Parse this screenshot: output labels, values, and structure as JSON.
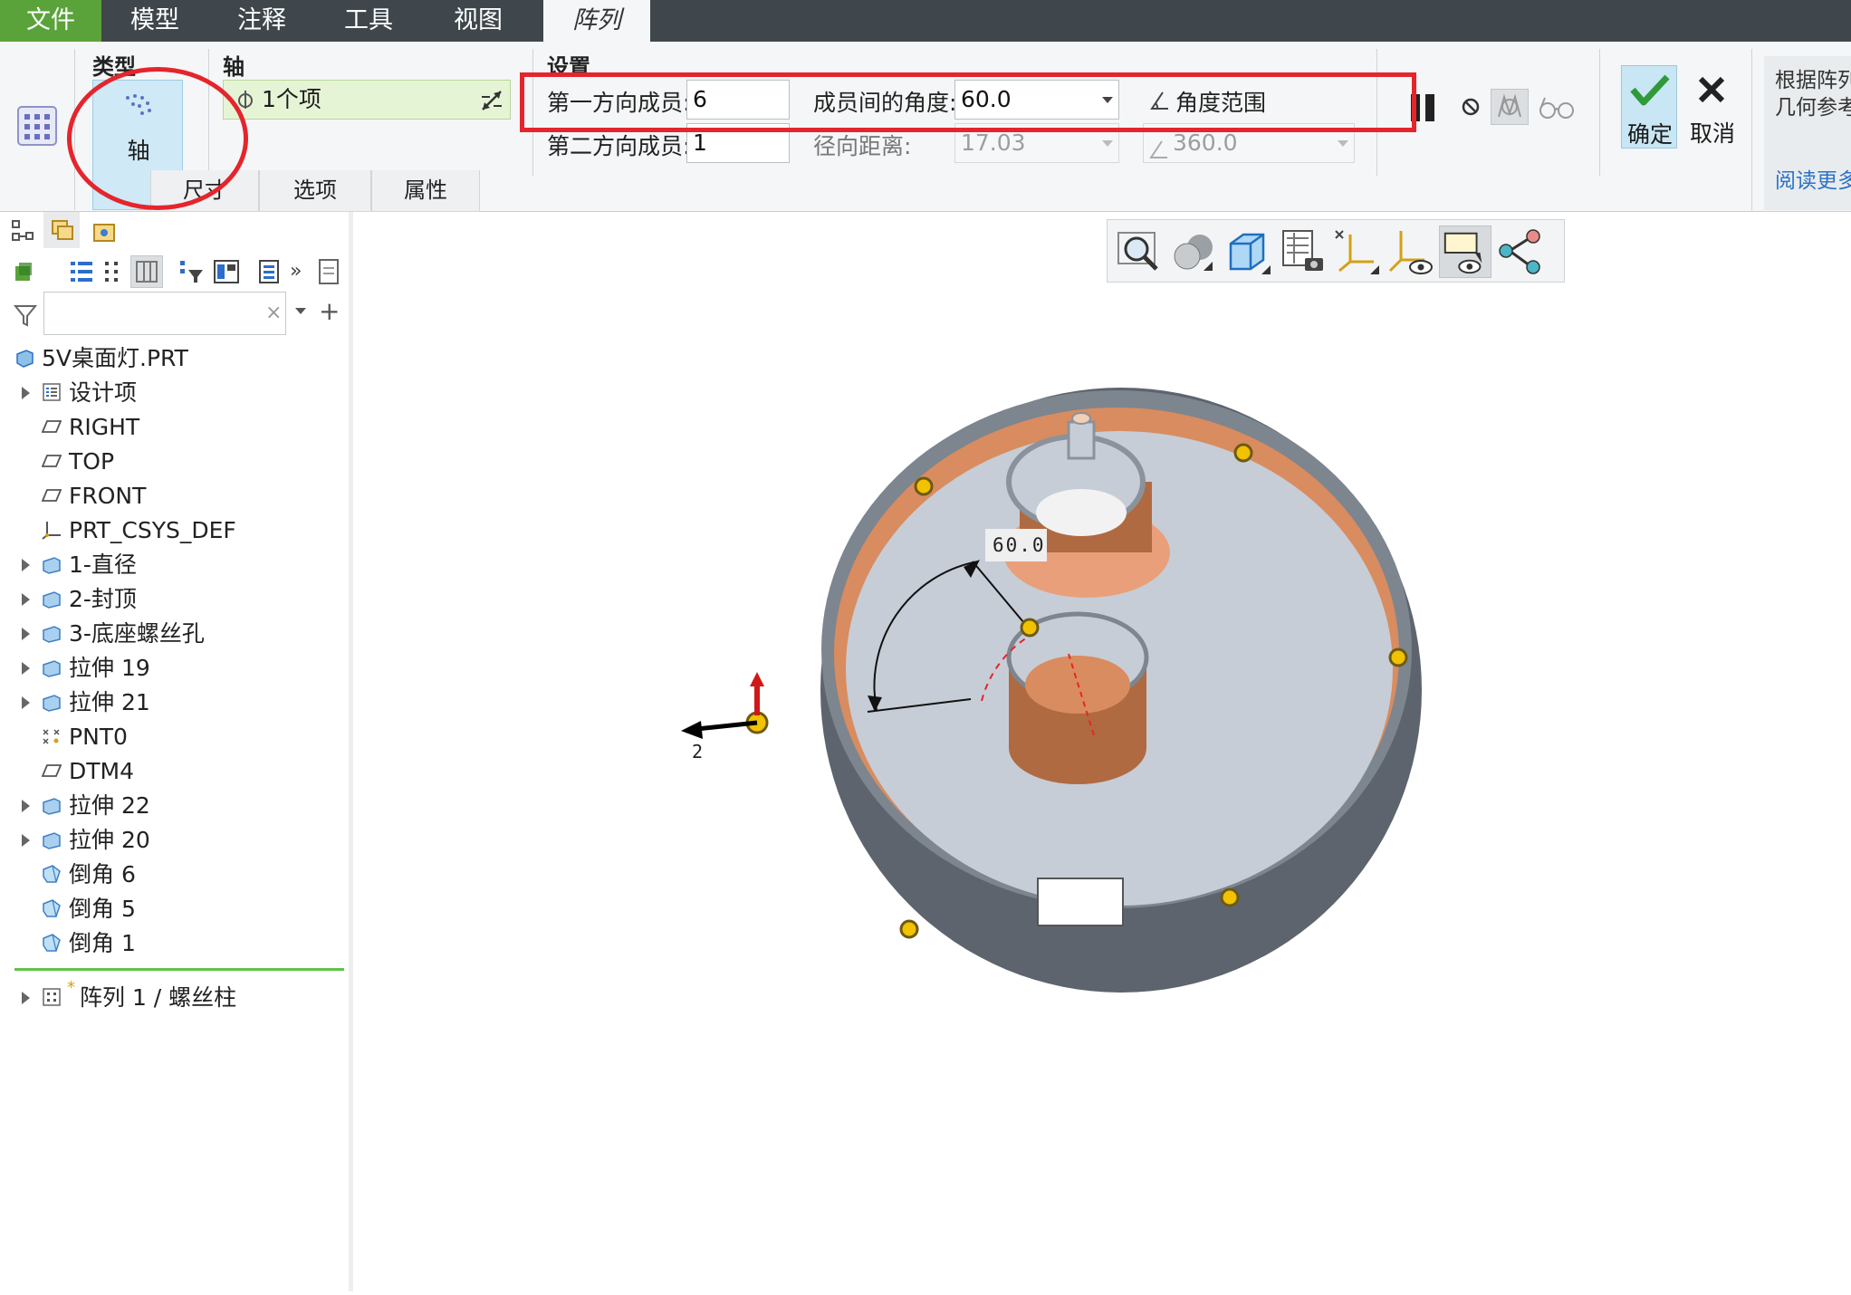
{
  "menubar": {
    "items": [
      "文件",
      "模型",
      "注释",
      "工具",
      "视图",
      "阵列"
    ],
    "active": "阵列"
  },
  "ribbon": {
    "type_group": {
      "title": "类型",
      "button_label": "轴"
    },
    "axis_group": {
      "title": "轴",
      "collector_value": "1个项"
    },
    "settings": {
      "title": "设置",
      "first_members_label": "第一方向成员:",
      "first_members_value": "6",
      "angle_label": "成员间的角度:",
      "angle_value": "60.0",
      "angle_range_label": "角度范围",
      "second_members_label": "第二方向成员:",
      "second_members_value": "1",
      "radial_label": "径向距离:",
      "radial_value": "17.03",
      "angle_range_value": "360.0"
    },
    "ok_label": "确定",
    "cancel_label": "取消",
    "help_text_line1": "根据阵列",
    "help_text_line2": "几何参考",
    "help_link": "阅读更多",
    "subtabs": [
      "尺寸",
      "选项",
      "属性"
    ]
  },
  "tree": {
    "items": [
      {
        "label": "5V桌面灯.PRT",
        "icon": "part-icon",
        "expandable": false,
        "level": 0
      },
      {
        "label": "设计项",
        "icon": "design-items-icon",
        "expandable": true,
        "level": 1
      },
      {
        "label": "RIGHT",
        "icon": "datum-plane-icon",
        "expandable": false,
        "level": 1
      },
      {
        "label": "TOP",
        "icon": "datum-plane-icon",
        "expandable": false,
        "level": 1
      },
      {
        "label": "FRONT",
        "icon": "datum-plane-icon",
        "expandable": false,
        "level": 1
      },
      {
        "label": "PRT_CSYS_DEF",
        "icon": "csys-icon",
        "expandable": false,
        "level": 1
      },
      {
        "label": "1-直径",
        "icon": "extrude-icon",
        "expandable": true,
        "level": 1
      },
      {
        "label": "2-封顶",
        "icon": "extrude-icon",
        "expandable": true,
        "level": 1
      },
      {
        "label": "3-底座螺丝孔",
        "icon": "extrude-icon",
        "expandable": true,
        "level": 1
      },
      {
        "label": "拉伸 19",
        "icon": "extrude-icon",
        "expandable": true,
        "level": 1
      },
      {
        "label": "拉伸 21",
        "icon": "extrude-icon",
        "expandable": true,
        "level": 1
      },
      {
        "label": "PNT0",
        "icon": "datum-point-icon",
        "expandable": false,
        "level": 1
      },
      {
        "label": "DTM4",
        "icon": "datum-plane-icon",
        "expandable": false,
        "level": 1
      },
      {
        "label": "拉伸 22",
        "icon": "extrude-icon",
        "expandable": true,
        "level": 1
      },
      {
        "label": "拉伸 20",
        "icon": "extrude-icon",
        "expandable": true,
        "level": 1
      },
      {
        "label": "倒角 6",
        "icon": "chamfer-icon",
        "expandable": false,
        "level": 1
      },
      {
        "label": "倒角 5",
        "icon": "chamfer-icon",
        "expandable": false,
        "level": 1
      },
      {
        "label": "倒角 1",
        "icon": "chamfer-icon",
        "expandable": false,
        "level": 1
      }
    ],
    "pattern_item": {
      "label": "阵列 1 / 螺丝柱",
      "marker": "*"
    }
  },
  "viewport": {
    "dimension_label": "60.0",
    "direction_label": "2"
  },
  "colors": {
    "menubar": "#3f474c",
    "file_menu": "#5aa33a",
    "highlight": "#e4252d",
    "ok_check": "#2f9a3a"
  }
}
